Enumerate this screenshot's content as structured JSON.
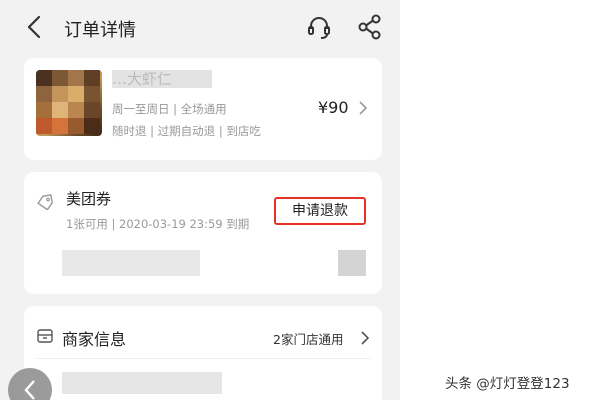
{
  "header": {
    "title": "订单详情",
    "back_icon": "back-arrow-icon",
    "service_icon": "headset-icon",
    "share_icon": "share-icon"
  },
  "product_card": {
    "name": "…大虾仁",
    "validity": "周一至周日 | 全场通用",
    "policies": "随时退 | 过期自动退 | 到店吃",
    "price": "¥90"
  },
  "coupon_card": {
    "title": "美团券",
    "detail": "1张可用 | 2020-03-19 23:59 到期",
    "refund_label": "申请退款",
    "highlight_color": "#e53328"
  },
  "merchant_card": {
    "title": "商家信息",
    "link": "2家门店通用"
  },
  "watermark": "头条 @灯灯登登123"
}
